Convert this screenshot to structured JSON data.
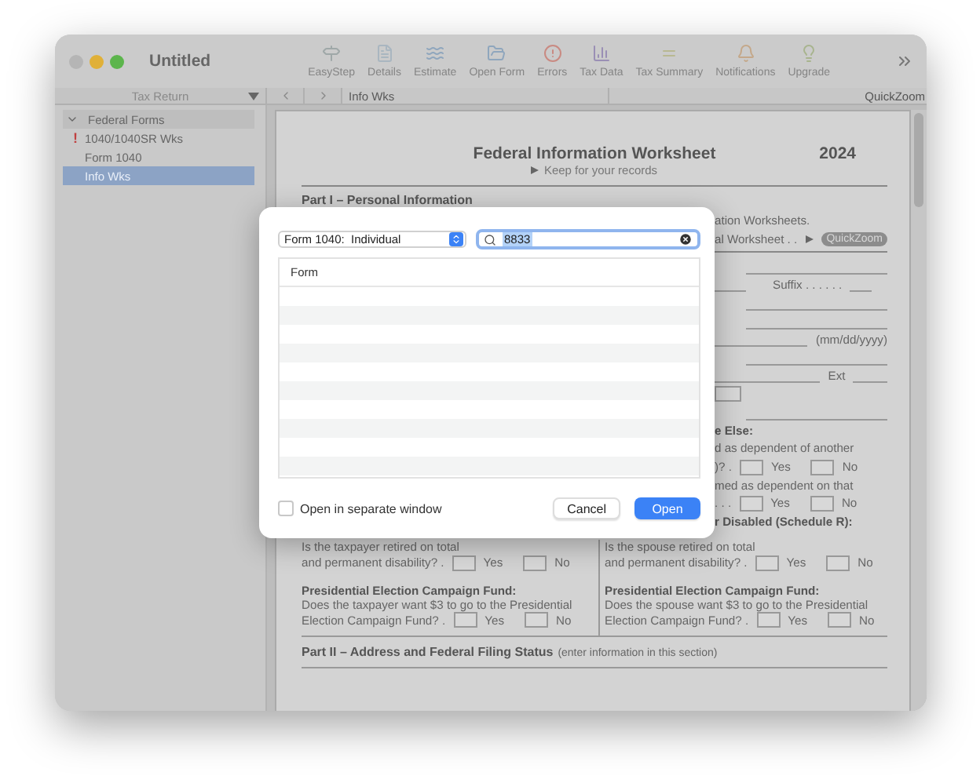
{
  "window": {
    "title": "Untitled"
  },
  "toolbar": [
    {
      "label": "EasyStep"
    },
    {
      "label": "Details"
    },
    {
      "label": "Estimate"
    },
    {
      "label": "Open Form"
    },
    {
      "label": "Errors"
    },
    {
      "label": "Tax Data"
    },
    {
      "label": "Tax Summary"
    },
    {
      "label": "Notifications"
    },
    {
      "label": "Upgrade"
    }
  ],
  "sidebar": {
    "dropdown": "Tax Return",
    "tree": [
      {
        "label": "Federal Forms",
        "expanded": true,
        "selected": false,
        "children": [
          {
            "label": "1040/1040SR Wks",
            "error_mark": "!",
            "selected": false
          },
          {
            "label": "Form 1040",
            "selected": false
          },
          {
            "label": "Info Wks",
            "selected": true
          }
        ]
      }
    ]
  },
  "navbar": {
    "breadcrumb": "Info Wks",
    "quickzoom": "QuickZoom"
  },
  "document": {
    "title": "Federal Information Worksheet",
    "year": "2024",
    "subtitle": "Keep for your records",
    "part1": "Part I – Personal Information",
    "fragments": [
      {
        "kind": "text",
        "text": "ation Worksheets."
      },
      {
        "kind": "quickzoom",
        "text": "al Worksheet . .",
        "button": "QuickZoom"
      },
      {
        "kind": "rule"
      },
      {
        "kind": "line"
      },
      {
        "kind": "suffix",
        "text": "Suffix . . . . . ."
      },
      {
        "kind": "line"
      },
      {
        "kind": "line"
      },
      {
        "kind": "date",
        "text": "(mm/dd/yyyy)"
      },
      {
        "kind": "line"
      },
      {
        "kind": "ext",
        "text": "Ext"
      },
      {
        "kind": "box"
      },
      {
        "kind": "line"
      },
      {
        "kind": "heading",
        "text": "e Else:"
      },
      {
        "kind": "text",
        "text": "d as dependent of another"
      },
      {
        "kind": "yesno",
        "text": ")? .",
        "yes": "Yes",
        "no": "No"
      },
      {
        "kind": "text",
        "text": "med as dependent on that"
      },
      {
        "kind": "yesno",
        "text": ". . .",
        "yes": "Yes",
        "no": "No"
      },
      {
        "kind": "heading",
        "text": "r Disabled (Schedule R):"
      }
    ],
    "columns": [
      {
        "blocks": [
          {
            "lines": [
              "Is the taxpayer retired on total"
            ],
            "question": "and permanent disability? .",
            "yes": "Yes",
            "no": "No"
          },
          {
            "heading": "Presidential Election Campaign Fund:",
            "lines": [
              "Does the taxpayer want $3 to go to the Presidential"
            ],
            "question": "Election Campaign Fund? .",
            "yes": "Yes",
            "no": "No"
          }
        ]
      },
      {
        "blocks": [
          {
            "lines": [
              "Is the spouse retired on total"
            ],
            "question": "and permanent disability? .",
            "yes": "Yes",
            "no": "No"
          },
          {
            "heading": "Presidential Election Campaign Fund:",
            "lines": [
              "Does the spouse want $3 to go to the Presidential"
            ],
            "question": "Election Campaign Fund? .",
            "yes": "Yes",
            "no": "No"
          }
        ]
      }
    ],
    "part2": "Part II – Address and Federal Filing Status",
    "part2_note": "(enter information in this section)"
  },
  "dialog": {
    "popup": "Form 1040:  Individual",
    "search": {
      "value": "8833",
      "value_selected": true
    },
    "column": "Form",
    "checkbox": {
      "label": "Open in separate window",
      "checked": false
    },
    "buttons": [
      {
        "label": "Cancel",
        "primary": false
      },
      {
        "label": "Open",
        "primary": true
      }
    ]
  }
}
